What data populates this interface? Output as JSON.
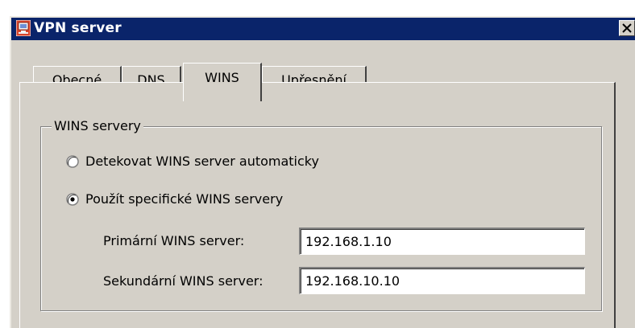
{
  "window": {
    "title": "VPN server",
    "close_label": "Close"
  },
  "tabs": [
    {
      "label": "Obecné",
      "active": false
    },
    {
      "label": "DNS",
      "active": false
    },
    {
      "label": "WINS",
      "active": true
    },
    {
      "label": "Upřesnění",
      "active": false
    }
  ],
  "wins_group": {
    "title": "WINS servery",
    "options": [
      {
        "label": "Detekovat WINS server automaticky",
        "selected": false
      },
      {
        "label": "Použít specifické WINS servery",
        "selected": true
      }
    ],
    "primary": {
      "label": "Primární WINS server:",
      "value": "192.168.1.10"
    },
    "secondary": {
      "label": "Sekundární WINS server:",
      "value": "192.168.10.10"
    }
  },
  "colors": {
    "titlebar": "#0a246a",
    "face": "#d4d0c8"
  }
}
